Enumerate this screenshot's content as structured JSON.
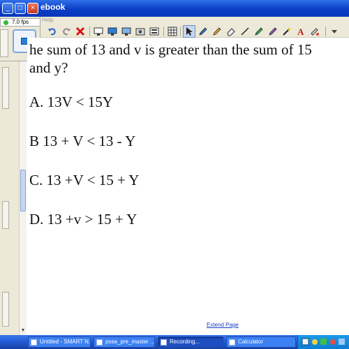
{
  "window": {
    "title": "ebook",
    "menu_help": "Help",
    "buttons": [
      "_",
      "□",
      "×"
    ]
  },
  "recorder": {
    "fps": "7.0 fps"
  },
  "toolbar": {
    "tools": [
      "undo-icon",
      "redo-icon",
      "delete-icon",
      "screen-shade-icon",
      "display-icon",
      "display-icon",
      "camera-icon",
      "full-screen-icon",
      "table-icon",
      "select-icon",
      "pen-icon",
      "creative-pen-icon",
      "eraser-icon",
      "line-icon",
      "shape-icon",
      "fill-icon",
      "magic-pen-icon",
      "text-icon",
      "properties-icon"
    ]
  },
  "content": {
    "question": "he sum of 13 and v is greater than the sum of 15 and y?",
    "answers": [
      "A. 13V < 15Y",
      "B 13 + V < 13 - Y",
      "C. 13 +V < 15 + Y",
      "D. 13 +v > 15 + Y"
    ],
    "extend_page": "Extend Page"
  },
  "taskbar": {
    "items": [
      "Untitled - SMART N...",
      "pssa_pre_master ...",
      "Recording...",
      "Calculator"
    ],
    "active_index": 2
  },
  "colors": {
    "titlebar": "#0a3ec7",
    "taskbar": "#245edb",
    "link": "#1a3dc2"
  }
}
